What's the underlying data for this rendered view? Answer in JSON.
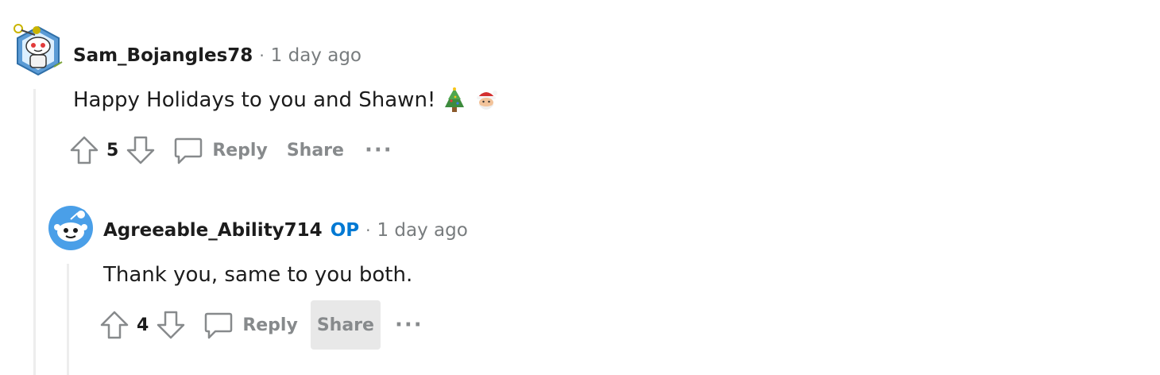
{
  "comments": [
    {
      "author": "Sam_Bojangles78",
      "op_badge": "",
      "separator": "·",
      "time": "1 day ago",
      "body": "Happy Holidays to you and Shawn!",
      "emojis": [
        "christmas-tree",
        "santa"
      ],
      "score": "5",
      "reply_label": "Reply",
      "share_label": "Share",
      "more_label": "···"
    },
    {
      "author": "Agreeable_Ability714",
      "op_badge": "OP",
      "separator": "·",
      "time": "1 day ago",
      "body": "Thank you, same to you both.",
      "score": "4",
      "reply_label": "Reply",
      "share_label": "Share",
      "more_label": "···"
    }
  ],
  "colors": {
    "op_accent": "#0079d3",
    "muted_text": "#787c7e",
    "action_text": "#878a8c",
    "thread_line": "#ededed",
    "hover_bg": "#e8e8e8"
  }
}
